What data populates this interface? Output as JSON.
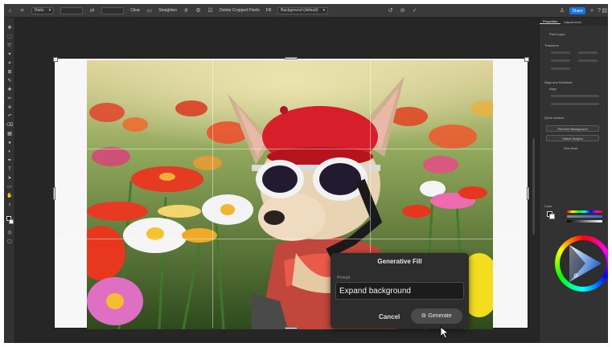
{
  "options_bar": {
    "preset_label": "Ratio",
    "clear_label": "Clear",
    "straighten_label": "Straighten",
    "delete_cropped_label": "Delete Cropped Pixels",
    "fill_label": "Fill",
    "fill_value": "Background (default)",
    "share_label": "Share"
  },
  "properties": {
    "tabs": [
      "Properties",
      "Adjustments"
    ],
    "layer_type": "Pixel Layer",
    "sections": {
      "transform": "Transform",
      "align": "Align and Distribute",
      "align_sub": "Align",
      "quick_actions": "Quick Actions"
    },
    "buttons": {
      "remove_background": "Remove Background",
      "select_subject": "Select Subject",
      "see_more": "See More"
    },
    "color_panel": "Color"
  },
  "generative_fill": {
    "title": "Generative Fill",
    "prompt_label": "Prompt",
    "prompt_value": "Expand background",
    "cancel_label": "Cancel",
    "generate_label": "Generate"
  },
  "colors": {
    "accent": "#1473e6",
    "panel_bg": "#323232",
    "canvas_bg": "#262626",
    "foreground_swatch": "#111111",
    "background_swatch": "#ffffff"
  }
}
